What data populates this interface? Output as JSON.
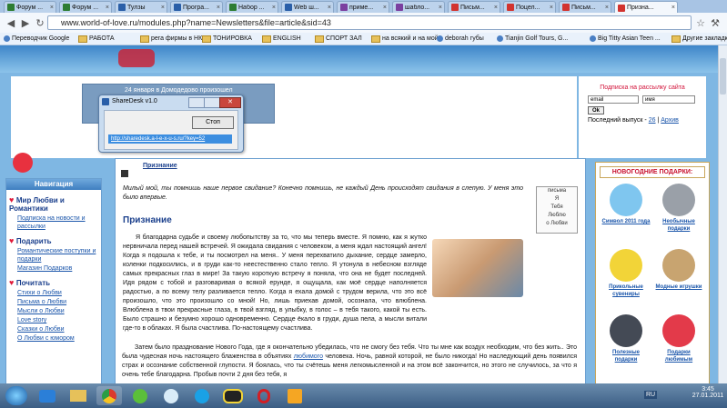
{
  "tabs": [
    {
      "label": "Форум ...",
      "color": "#2e7d32"
    },
    {
      "label": "Форум ...",
      "color": "#2e7d32"
    },
    {
      "label": "Тулзы",
      "color": "#2a5fa8"
    },
    {
      "label": "Програ...",
      "color": "#2a5fa8"
    },
    {
      "label": "Набор ...",
      "color": "#2e7d32"
    },
    {
      "label": "Web ш...",
      "color": "#2a5fa8"
    },
    {
      "label": "приме...",
      "color": "#7b3fa0"
    },
    {
      "label": "шабло...",
      "color": "#7b3fa0"
    },
    {
      "label": "Письм...",
      "color": "#d2332f"
    },
    {
      "label": "Поцел...",
      "color": "#d2332f"
    },
    {
      "label": "Письм...",
      "color": "#d2332f"
    },
    {
      "label": "Призна...",
      "color": "#d2332f"
    }
  ],
  "address": {
    "url": "www.world-of-love.ru/modules.php?name=Newsletters&file=article&sid=43"
  },
  "bookmarks": [
    {
      "label": "Переводчик Google",
      "icon": "google"
    },
    {
      "label": "РАБОТА",
      "icon": "folder"
    },
    {
      "label": "рега фирмы в НК",
      "icon": "folder"
    },
    {
      "label": "ТОНИРОВКА",
      "icon": "folder"
    },
    {
      "label": "ENGLISH",
      "icon": "folder"
    },
    {
      "label": "СПОРТ ЗАЛ",
      "icon": "folder"
    },
    {
      "label": "на всякий и на мой",
      "icon": "folder"
    },
    {
      "label": "deborah губы",
      "icon": "site"
    },
    {
      "label": "Tianjin Golf Tours, G...",
      "icon": "site"
    },
    {
      "label": "Big Titty Asian Teen ...",
      "icon": "site"
    },
    {
      "label": "Другие закладки",
      "icon": "folder"
    }
  ],
  "banner": {
    "text": "24 января в Домодедово произошел"
  },
  "sharedesk": {
    "title": "ShareDesk v1.0",
    "stop": "Стоп",
    "link": "http://sharedesk.a-l-e-x-u-s.ru/?key=52"
  },
  "subscribe": {
    "title": "Подписка на рассылку сайта",
    "email": "email",
    "name": "имя",
    "ok": "Ok",
    "last_label": "Последний выпуск -",
    "last_num": "26",
    "sep": "|",
    "archive": "Архив"
  },
  "nav": {
    "header": "Навигация",
    "sections": [
      {
        "title": "Мир Любви и Романтики",
        "links": [
          "Подписка на новости и рассылки"
        ]
      },
      {
        "title": "Подарить",
        "links": [
          "Романтические поступки и подарки",
          "Магазин Подарков"
        ]
      },
      {
        "title": "Почитать",
        "links": [
          "Стихи о Любви",
          "Письма о Любви",
          "Мысли о Любви",
          "Love story",
          "Сказки о Любви",
          "О Любви с юмором"
        ]
      }
    ]
  },
  "article": {
    "crumb": "Признание",
    "intro": "Милый мой, ты помнишь наше первое свидание? Конечно помнишь, не каждый День происходят свидания в слепую. У меня это было впервые.",
    "heading": "Признание",
    "para1": "Я благодарна судьбе и своему любопытству за то, что мы теперь вместе. Я помню, как я жутко нервничала перед нашей встречей. Я ожидала свидания с человеком, а меня ждал настоящий ангел! Когда я подошла к тебе, и ты посмотрел на меня.. У меня перехватило дыхание, сердце замерло, коленки подкосились, и в груди как-то неестественно стало тепло. Я утонула в небесном взгляде самых прекрасных глаз в мире! За такую короткую встречу я поняла, что она не будет последней. Идя рядом с тобой и разговаривая о всякой ерунде, я ощущала, как моё сердце наполняется радостью, а по всему телу разливается тепло. Когда я ехала домой с трудом верила, что это всё произошло, что это произошло со мной! Но, лишь приехав домой, осознала, что влюблена. Влюблена в твои прекрасные глаза, в твой взгляд, в улыбку, в голос – в тебя такого, какой ты есть. Было страшно и безумно хорошо одновременно. Сердце ёкало в груди, душа пела, а мысли витали где-то в облаках. Я была счастлива. По-настоящему счастлива.",
    "para2a": "Затем было празднование Нового Года, где я окончательно убедилась, что не смогу без тебя. Что ты мне как воздух необходим, что без жить.. Это была чудесная ночь настоящего блаженства в объятиях",
    "para2link": "любимого",
    "para2b": "человека. Ночь, равной которой, не было никогда! Но наследующий день появился страх и осознание собственной глупости. Я боялась, что ты счётешь меня легкомысленной и на этом всё закончится, но этого не случилось, за что я очень тебе благодарна. Пробыв почти 2 дня без тебя, я",
    "letter": [
      "письма",
      "Я",
      "Тебя",
      "Люблю",
      "о Любви"
    ]
  },
  "gifts": {
    "title": "НОВОГОДНИЕ ПОДАРКИ:",
    "items": [
      {
        "label": "Символ 2011 года",
        "icon": "rabbit-icon"
      },
      {
        "label": "Необычные подарки",
        "icon": "cube-icon"
      },
      {
        "label": "Прикольные сувениры",
        "icon": "smiley-icon"
      },
      {
        "label": "Модные игрушки",
        "icon": "toy-icon"
      },
      {
        "label": "Полезные подарки",
        "icon": "gadget-icon"
      },
      {
        "label": "Подарки любимым",
        "icon": "heart-face-icon"
      }
    ]
  },
  "taskbar": {
    "lang": "RU",
    "time": "3:45",
    "date": "27.01.2011"
  }
}
